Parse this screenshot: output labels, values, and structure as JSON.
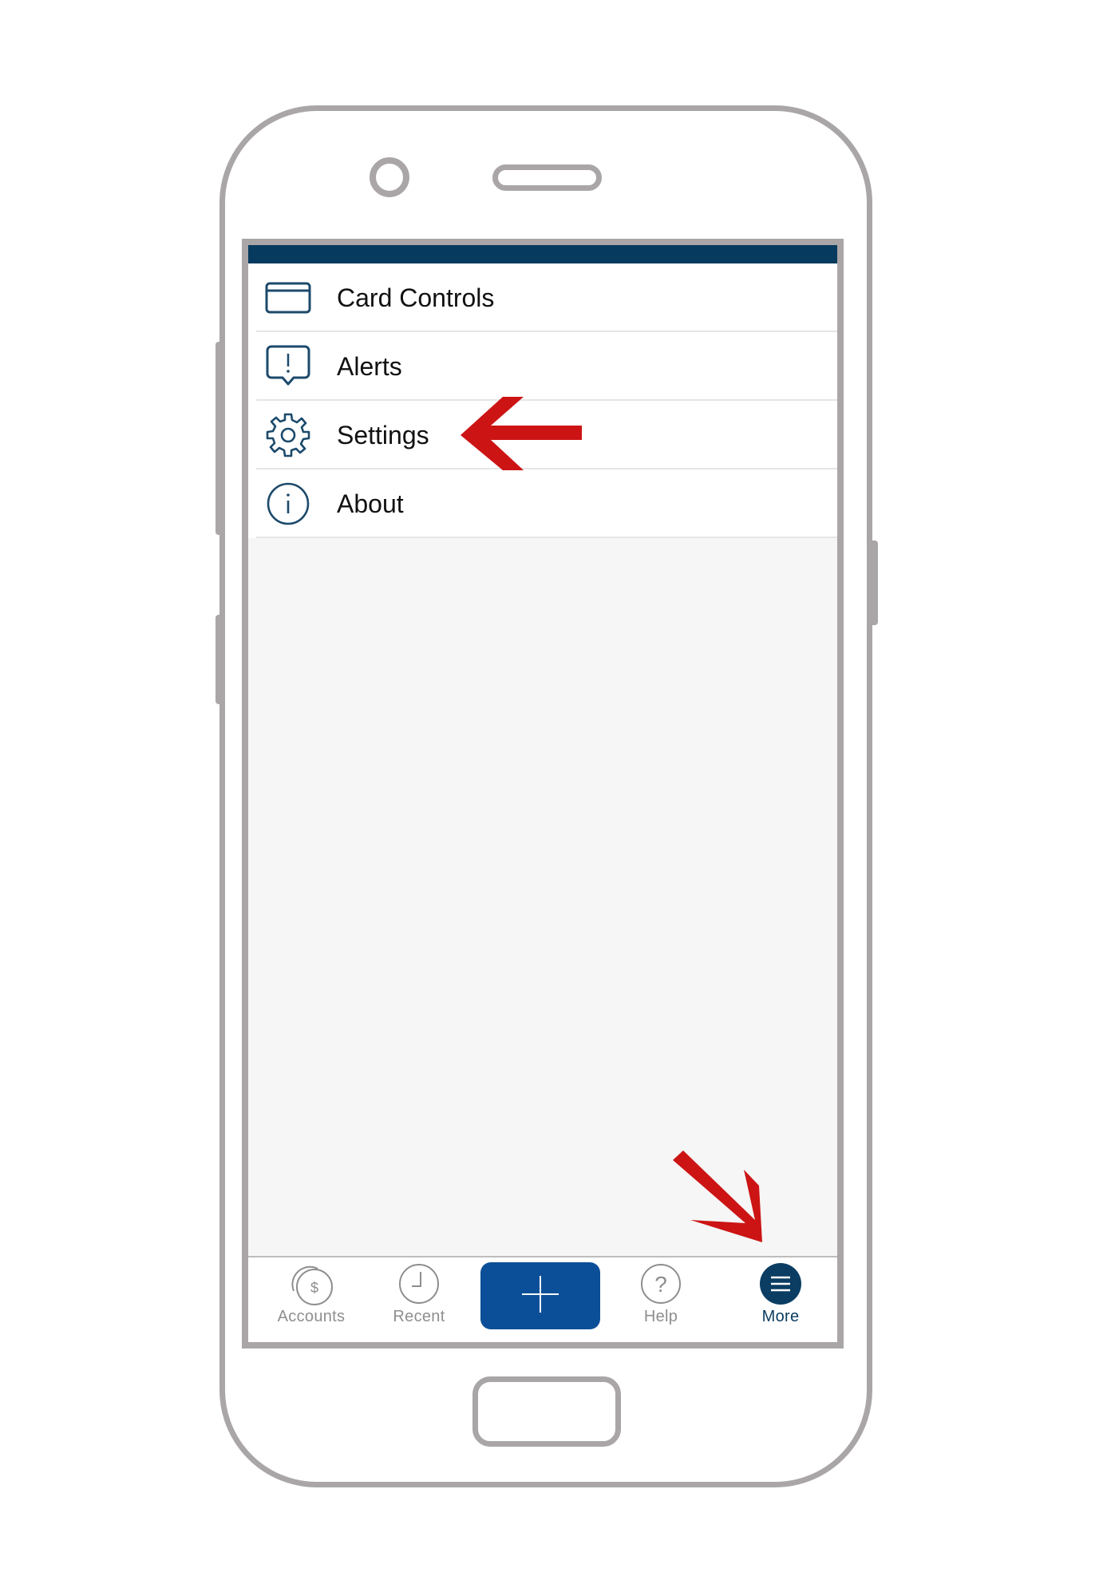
{
  "menu": {
    "items": [
      {
        "label": "Card Controls",
        "icon": "credit-card-icon"
      },
      {
        "label": "Alerts",
        "icon": "alert-bubble-icon"
      },
      {
        "label": "Settings",
        "icon": "gear-icon"
      },
      {
        "label": "About",
        "icon": "info-icon"
      }
    ]
  },
  "tabbar": {
    "tabs": [
      {
        "label": "Accounts",
        "icon": "coins-dollar-icon",
        "active": false
      },
      {
        "label": "Recent",
        "icon": "clock-icon",
        "active": false
      },
      {
        "label": "",
        "icon": "plus-icon",
        "active": false
      },
      {
        "label": "Help",
        "icon": "question-circle-icon",
        "active": false
      },
      {
        "label": "More",
        "icon": "hamburger-menu-icon",
        "active": true
      }
    ]
  },
  "colors": {
    "header_bar": "#063a5e",
    "icon_stroke": "#1c4a6b",
    "primary_button": "#0b4f98",
    "active_tab": "#0b3d62",
    "inactive_tab": "#8e8e8e",
    "annotation_arrow": "#cc1414",
    "device_outline": "#aaa6a7"
  },
  "annotations": [
    {
      "type": "arrow",
      "direction": "left",
      "points_to": "Settings"
    },
    {
      "type": "arrow",
      "direction": "down-right",
      "points_to": "More"
    }
  ]
}
